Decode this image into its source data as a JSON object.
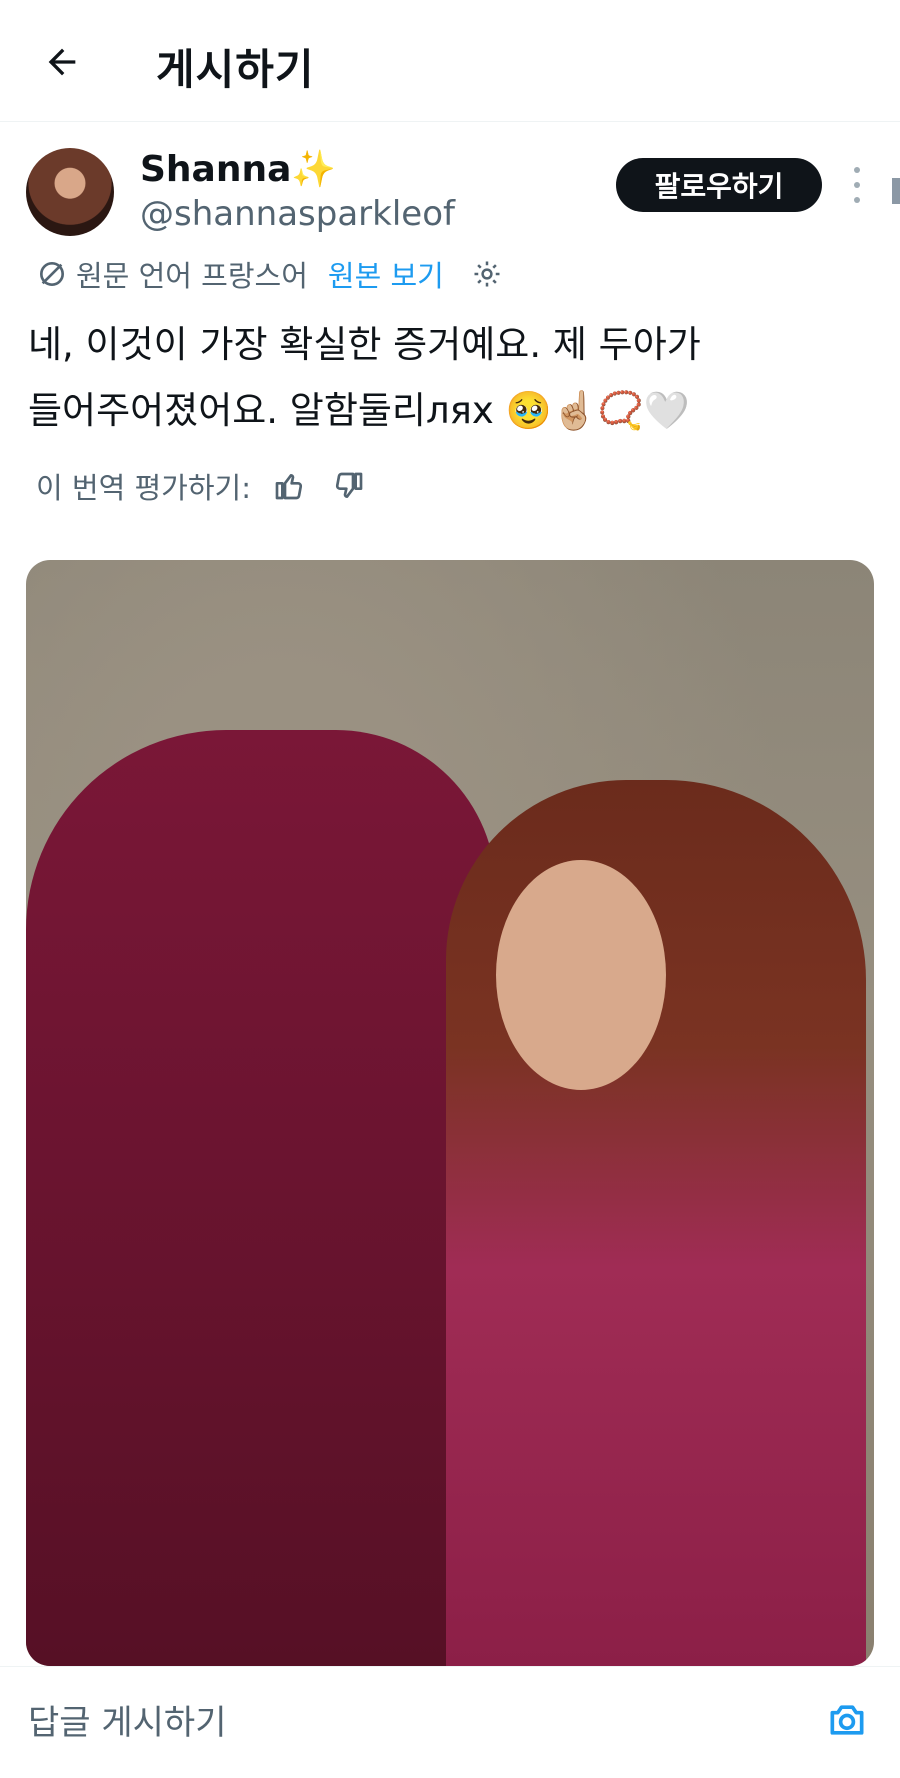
{
  "header": {
    "title": "게시하기",
    "back_icon": "arrow-left-icon"
  },
  "post": {
    "author": {
      "display_name": "Shanna✨",
      "handle": "@shannasparkleof"
    },
    "follow_label": "팔로우하기",
    "translation": {
      "original_language_label": "원문 언어 프랑스어",
      "view_original_label": "원본 보기"
    },
    "text_lines": [
      "네, 이것이 가장 확실한 증거예요. 제 두아가",
      "들어주어졌어요. 알함둘리лях 🥹☝🏼📿🤍"
    ],
    "rate_translation_label": "이 번역 평가하기:"
  },
  "reply": {
    "placeholder": "답글 게시하기"
  },
  "colors": {
    "accent": "#1d9bf0",
    "text_primary": "#0f1419",
    "text_secondary": "#536471",
    "follow_button_bg": "#0f1419"
  }
}
